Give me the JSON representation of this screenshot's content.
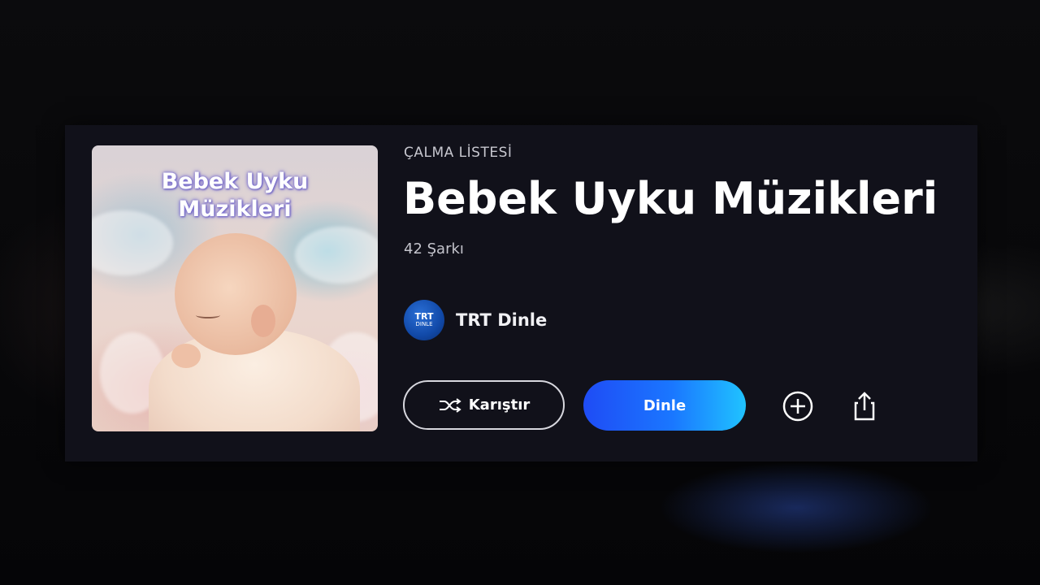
{
  "playlist": {
    "type_label": "ÇALMA LİSTESİ",
    "title": "Bebek Uyku Müzikleri",
    "count": "42 Şarkı",
    "cover": {
      "title_text": "Bebek Uyku\nMüzikleri",
      "image_icon": "sleeping-baby-image"
    },
    "publisher": {
      "name": "TRT Dinle",
      "logo_top": "TRT",
      "logo_bottom": "DINLE",
      "logo_color": "#1149a8"
    }
  },
  "actions": {
    "shuffle_label": "Karıştır",
    "shuffle_icon": "shuffle-icon",
    "play_label": "Dinle",
    "add_icon": "plus-circle-icon",
    "share_icon": "share-icon"
  },
  "colors": {
    "card_background": "#11111a",
    "play_gradient_start": "#1f4cf5",
    "play_gradient_end": "#20c3ff",
    "text_primary": "#ffffff"
  }
}
